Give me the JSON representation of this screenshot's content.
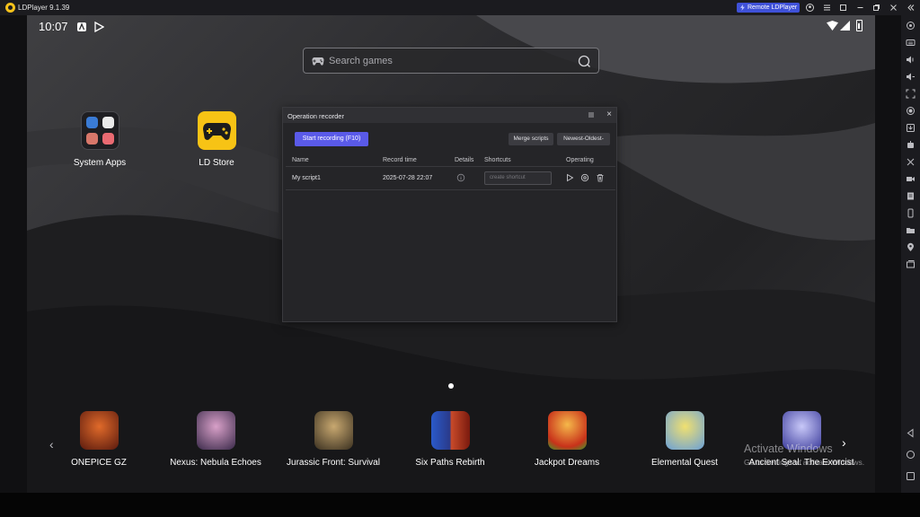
{
  "window": {
    "title": "LDPlayer 9.1.39",
    "remote_label": "Remote LDPlayer"
  },
  "statusbar": {
    "time": "10:07"
  },
  "search": {
    "placeholder": "Search games"
  },
  "desktop_apps": [
    {
      "label": "System Apps",
      "icon": "folder-icon"
    },
    {
      "label": "LD Store",
      "icon": "gamepad-icon"
    }
  ],
  "recorder": {
    "title": "Operation recorder",
    "start_label": "Start recording  (F10)",
    "merge_label": "Merge scripts",
    "sort_label": "Newest-Oldest-",
    "columns": [
      "Name",
      "Record time",
      "Details",
      "Shortcuts",
      "Operating"
    ],
    "rows": [
      {
        "name": "My script1",
        "record_time": "2025-07-28 22:07",
        "shortcut_placeholder": "create shortcut"
      }
    ]
  },
  "dock": {
    "apps": [
      {
        "label": "ONEPICE GZ",
        "color": "#7a2a12"
      },
      {
        "label": "Nexus: Nebula Echoes",
        "color": "#7a4a8a"
      },
      {
        "label": "Jurassic Front: Survival",
        "color": "#8a6a3a"
      },
      {
        "label": "Six Paths Rebirth",
        "color": "#3a4a9a"
      },
      {
        "label": "Jackpot Dreams",
        "color": "#d2461a"
      },
      {
        "label": "Elemental Quest",
        "color": "#c8b02a"
      },
      {
        "label": "Ancient Seal: The Exorcist",
        "color": "#6a6acf"
      }
    ]
  },
  "watermark": {
    "line1": "Activate Windows",
    "line2": "Go to Settings to activate Windows."
  },
  "colors": {
    "accent": "#5a5ae8",
    "remote": "#3f51d8",
    "ld_yellow": "#f7c315"
  }
}
